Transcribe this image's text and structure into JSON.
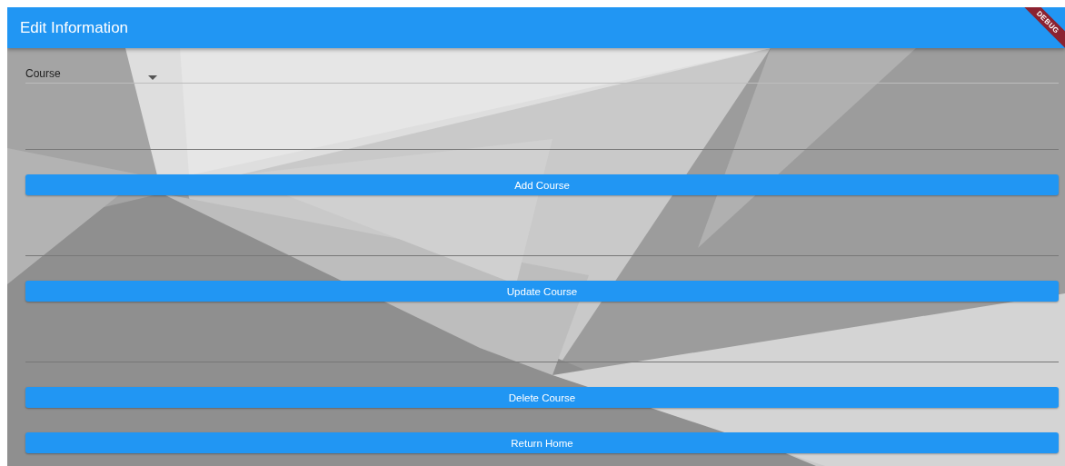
{
  "app_bar": {
    "title": "Edit Information",
    "debug_banner": "DEBUG"
  },
  "dropdown": {
    "value": "Course"
  },
  "form": [
    {
      "kind": "field"
    },
    {
      "kind": "button",
      "label": "Add Course"
    },
    {
      "kind": "field"
    },
    {
      "kind": "button",
      "label": "Update Course"
    },
    {
      "kind": "field"
    },
    {
      "kind": "button",
      "label": "Delete Course"
    },
    {
      "kind": "button",
      "label": "Return Home"
    }
  ]
}
